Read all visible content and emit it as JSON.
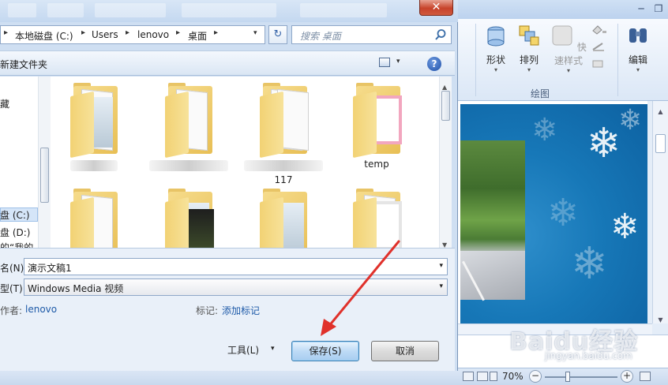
{
  "ppt": {
    "window_controls": {
      "minimize": "─",
      "restore": "❐"
    },
    "ribbon": {
      "shapes_label": "形状",
      "arrange_label": "排列",
      "quick_styles_label": "快速样式",
      "edit_label": "编辑",
      "group_drawing_label": "绘图"
    },
    "status": {
      "zoom": "70%"
    },
    "watermark": {
      "brand": "Baidu经验",
      "url": "jingyan.baidu.com"
    }
  },
  "dialog": {
    "close_symbol": "✕",
    "address": {
      "crumbs": [
        "本地磁盘 (C:)",
        "Users",
        "lenovo",
        "桌面"
      ],
      "separator": "▸",
      "dropdown": "▾"
    },
    "refresh_symbol": "↻",
    "search": {
      "placeholder": "搜索 桌面"
    },
    "toolbar": {
      "new_folder": "新建文件夹",
      "help": "?",
      "view_dropdown": "▾"
    },
    "nav": {
      "items": [
        "藏",
        "盘 (C:)",
        "盘 (D:)",
        "的“我的"
      ]
    },
    "files": [
      {
        "label": "",
        "blurred": true
      },
      {
        "label": "",
        "blurred": true
      },
      {
        "label": "117",
        "blurred": true
      },
      {
        "label": "temp",
        "blurred": false
      },
      {
        "label": "",
        "blurred": false
      },
      {
        "label": "",
        "blurred": false
      },
      {
        "label": "",
        "blurred": false
      },
      {
        "label": "",
        "blurred": false
      }
    ],
    "form": {
      "filename_label": "名(N):",
      "filename_value": "演示文稿1",
      "filetype_label": "型(T):",
      "filetype_value": "Windows Media 视频",
      "author_label": "作者:",
      "author_value": "lenovo",
      "tags_label": "标记:",
      "tags_value": "添加标记"
    },
    "buttons": {
      "tools": "工具(L)",
      "save": "保存(S)",
      "cancel": "取消"
    },
    "dropdown_symbol": "▾"
  },
  "colors": {
    "accent_arrow": "#e0312b",
    "link_blue": "#1e5aa8",
    "slide_blue": "#1778b8"
  }
}
